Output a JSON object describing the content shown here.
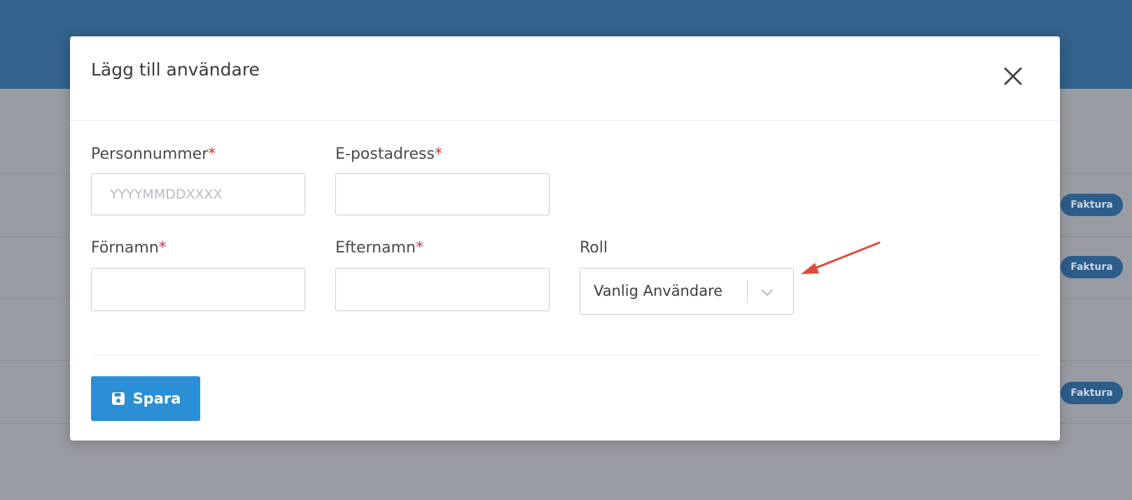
{
  "background": {
    "badges": [
      "Faktura",
      "Faktura",
      "Faktura"
    ]
  },
  "modal": {
    "title": "Lägg till användare",
    "close_icon": "close-icon",
    "fields": {
      "personnummer": {
        "label": "Personnummer",
        "required_mark": "*",
        "placeholder": "YYYYMMDDXXXX",
        "value": ""
      },
      "epost": {
        "label": "E-postadress",
        "required_mark": "*",
        "placeholder": "",
        "value": ""
      },
      "fornamn": {
        "label": "Förnamn",
        "required_mark": "*",
        "placeholder": "",
        "value": ""
      },
      "efternamn": {
        "label": "Efternamn",
        "required_mark": "*",
        "placeholder": "",
        "value": ""
      },
      "roll": {
        "label": "Roll",
        "selected": "Vanlig Användare"
      }
    },
    "save_button": {
      "label": "Spara",
      "icon": "save-icon"
    }
  },
  "colors": {
    "header": "#33628c",
    "primary_button": "#2b8fd6",
    "required": "#e0333a",
    "annotation_arrow": "#e04a3a"
  }
}
